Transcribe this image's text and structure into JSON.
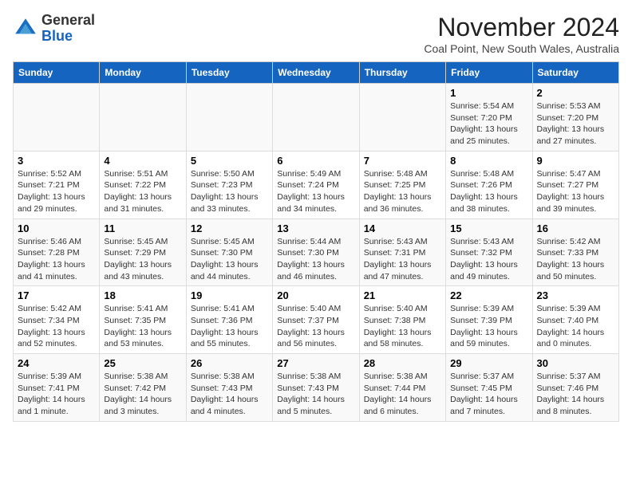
{
  "header": {
    "logo_general": "General",
    "logo_blue": "Blue",
    "month": "November 2024",
    "location": "Coal Point, New South Wales, Australia"
  },
  "days_of_week": [
    "Sunday",
    "Monday",
    "Tuesday",
    "Wednesday",
    "Thursday",
    "Friday",
    "Saturday"
  ],
  "weeks": [
    [
      {
        "day": "",
        "info": ""
      },
      {
        "day": "",
        "info": ""
      },
      {
        "day": "",
        "info": ""
      },
      {
        "day": "",
        "info": ""
      },
      {
        "day": "",
        "info": ""
      },
      {
        "day": "1",
        "info": "Sunrise: 5:54 AM\nSunset: 7:20 PM\nDaylight: 13 hours\nand 25 minutes."
      },
      {
        "day": "2",
        "info": "Sunrise: 5:53 AM\nSunset: 7:20 PM\nDaylight: 13 hours\nand 27 minutes."
      }
    ],
    [
      {
        "day": "3",
        "info": "Sunrise: 5:52 AM\nSunset: 7:21 PM\nDaylight: 13 hours\nand 29 minutes."
      },
      {
        "day": "4",
        "info": "Sunrise: 5:51 AM\nSunset: 7:22 PM\nDaylight: 13 hours\nand 31 minutes."
      },
      {
        "day": "5",
        "info": "Sunrise: 5:50 AM\nSunset: 7:23 PM\nDaylight: 13 hours\nand 33 minutes."
      },
      {
        "day": "6",
        "info": "Sunrise: 5:49 AM\nSunset: 7:24 PM\nDaylight: 13 hours\nand 34 minutes."
      },
      {
        "day": "7",
        "info": "Sunrise: 5:48 AM\nSunset: 7:25 PM\nDaylight: 13 hours\nand 36 minutes."
      },
      {
        "day": "8",
        "info": "Sunrise: 5:48 AM\nSunset: 7:26 PM\nDaylight: 13 hours\nand 38 minutes."
      },
      {
        "day": "9",
        "info": "Sunrise: 5:47 AM\nSunset: 7:27 PM\nDaylight: 13 hours\nand 39 minutes."
      }
    ],
    [
      {
        "day": "10",
        "info": "Sunrise: 5:46 AM\nSunset: 7:28 PM\nDaylight: 13 hours\nand 41 minutes."
      },
      {
        "day": "11",
        "info": "Sunrise: 5:45 AM\nSunset: 7:29 PM\nDaylight: 13 hours\nand 43 minutes."
      },
      {
        "day": "12",
        "info": "Sunrise: 5:45 AM\nSunset: 7:30 PM\nDaylight: 13 hours\nand 44 minutes."
      },
      {
        "day": "13",
        "info": "Sunrise: 5:44 AM\nSunset: 7:30 PM\nDaylight: 13 hours\nand 46 minutes."
      },
      {
        "day": "14",
        "info": "Sunrise: 5:43 AM\nSunset: 7:31 PM\nDaylight: 13 hours\nand 47 minutes."
      },
      {
        "day": "15",
        "info": "Sunrise: 5:43 AM\nSunset: 7:32 PM\nDaylight: 13 hours\nand 49 minutes."
      },
      {
        "day": "16",
        "info": "Sunrise: 5:42 AM\nSunset: 7:33 PM\nDaylight: 13 hours\nand 50 minutes."
      }
    ],
    [
      {
        "day": "17",
        "info": "Sunrise: 5:42 AM\nSunset: 7:34 PM\nDaylight: 13 hours\nand 52 minutes."
      },
      {
        "day": "18",
        "info": "Sunrise: 5:41 AM\nSunset: 7:35 PM\nDaylight: 13 hours\nand 53 minutes."
      },
      {
        "day": "19",
        "info": "Sunrise: 5:41 AM\nSunset: 7:36 PM\nDaylight: 13 hours\nand 55 minutes."
      },
      {
        "day": "20",
        "info": "Sunrise: 5:40 AM\nSunset: 7:37 PM\nDaylight: 13 hours\nand 56 minutes."
      },
      {
        "day": "21",
        "info": "Sunrise: 5:40 AM\nSunset: 7:38 PM\nDaylight: 13 hours\nand 58 minutes."
      },
      {
        "day": "22",
        "info": "Sunrise: 5:39 AM\nSunset: 7:39 PM\nDaylight: 13 hours\nand 59 minutes."
      },
      {
        "day": "23",
        "info": "Sunrise: 5:39 AM\nSunset: 7:40 PM\nDaylight: 14 hours\nand 0 minutes."
      }
    ],
    [
      {
        "day": "24",
        "info": "Sunrise: 5:39 AM\nSunset: 7:41 PM\nDaylight: 14 hours\nand 1 minute."
      },
      {
        "day": "25",
        "info": "Sunrise: 5:38 AM\nSunset: 7:42 PM\nDaylight: 14 hours\nand 3 minutes."
      },
      {
        "day": "26",
        "info": "Sunrise: 5:38 AM\nSunset: 7:43 PM\nDaylight: 14 hours\nand 4 minutes."
      },
      {
        "day": "27",
        "info": "Sunrise: 5:38 AM\nSunset: 7:43 PM\nDaylight: 14 hours\nand 5 minutes."
      },
      {
        "day": "28",
        "info": "Sunrise: 5:38 AM\nSunset: 7:44 PM\nDaylight: 14 hours\nand 6 minutes."
      },
      {
        "day": "29",
        "info": "Sunrise: 5:37 AM\nSunset: 7:45 PM\nDaylight: 14 hours\nand 7 minutes."
      },
      {
        "day": "30",
        "info": "Sunrise: 5:37 AM\nSunset: 7:46 PM\nDaylight: 14 hours\nand 8 minutes."
      }
    ]
  ]
}
